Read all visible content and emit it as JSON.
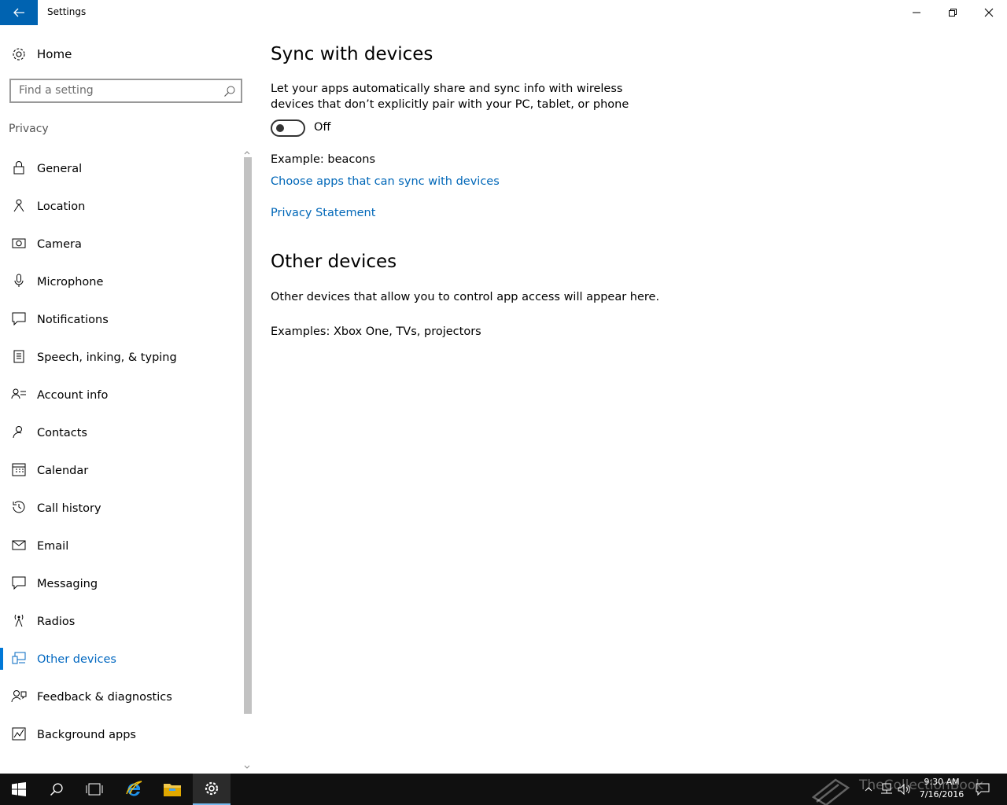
{
  "window": {
    "title": "Settings"
  },
  "sidebar": {
    "home_label": "Home",
    "search_placeholder": "Find a setting",
    "section": "Privacy",
    "items": [
      {
        "label": "General",
        "icon": "lock-icon"
      },
      {
        "label": "Location",
        "icon": "location-icon"
      },
      {
        "label": "Camera",
        "icon": "camera-icon"
      },
      {
        "label": "Microphone",
        "icon": "microphone-icon"
      },
      {
        "label": "Notifications",
        "icon": "notifications-icon"
      },
      {
        "label": "Speech, inking, & typing",
        "icon": "clipboard-icon"
      },
      {
        "label": "Account info",
        "icon": "account-icon"
      },
      {
        "label": "Contacts",
        "icon": "contacts-icon"
      },
      {
        "label": "Calendar",
        "icon": "calendar-icon"
      },
      {
        "label": "Call history",
        "icon": "history-icon"
      },
      {
        "label": "Email",
        "icon": "mail-icon"
      },
      {
        "label": "Messaging",
        "icon": "message-icon"
      },
      {
        "label": "Radios",
        "icon": "radio-tower-icon"
      },
      {
        "label": "Other devices",
        "icon": "devices-icon",
        "active": true
      },
      {
        "label": "Feedback & diagnostics",
        "icon": "feedback-icon"
      },
      {
        "label": "Background apps",
        "icon": "chart-icon"
      }
    ]
  },
  "main": {
    "sync_title": "Sync with devices",
    "sync_desc_line1": "Let your apps automatically share and sync info with wireless",
    "sync_desc_line2": "devices that don’t explicitly pair with your PC, tablet, or phone",
    "toggle_state": "Off",
    "example": "Example: beacons",
    "choose_apps_link": "Choose apps that can sync with devices",
    "privacy_link": "Privacy Statement",
    "other_title": "Other devices",
    "other_desc": "Other devices that allow you to control app access will appear here.",
    "other_examples": "Examples: Xbox One, TVs, projectors"
  },
  "taskbar": {
    "time": "9:30 AM",
    "date": "7/16/2016",
    "watermark": "TheCollectionBook"
  },
  "colors": {
    "accent": "#0078d7",
    "link": "#0067b8",
    "titlebar_back": "#0063b1",
    "taskbar": "#101010"
  }
}
